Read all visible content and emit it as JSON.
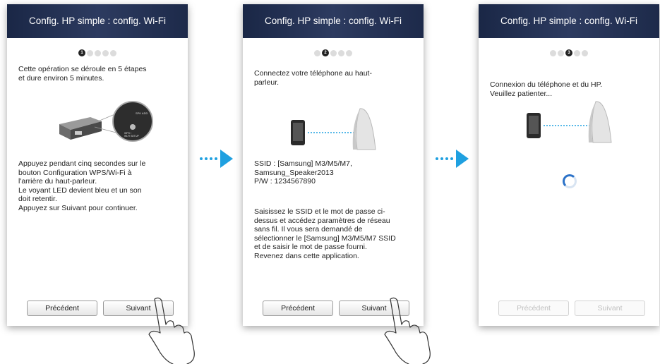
{
  "colors": {
    "header_bg": "#1f2b4c",
    "accent_blue": "#1fa0e0",
    "spinner_blue": "#2b72c8"
  },
  "screens": [
    {
      "title": "Config. HP simple : config. Wi-Fi",
      "step_dots": [
        "1",
        "",
        "",
        "",
        ""
      ],
      "intro": "Cette opération se déroule en 5 étapes\net dure environ 5 minutes.",
      "instructions": "Appuyez pendant cinq secondes sur le\nbouton Configuration WPS/Wi-Fi à\nl'arrière du haut-parleur.\nLe voyant LED devient bleu et un son\ndoit retentir.\nAppuyez sur Suivant pour continuer.",
      "prev_label": "Précédent",
      "next_label": "Suivant"
    },
    {
      "title": "Config. HP simple : config. Wi-Fi",
      "step_dots": [
        "",
        "2",
        "",
        "",
        ""
      ],
      "intro": "Connectez votre téléphone au haut-\nparleur.",
      "ssid_info": "SSID : [Samsung] M3/M5/M7,\n          Samsung_Speaker2013\nP/W : 1234567890",
      "instructions": "Saisissez le SSID et le mot de passe ci-\ndessus et accédez paramètres de réseau\nsans fil. Il vous sera demandé de\nsélectionner le [Samsung] M3/M5/M7 SSID\net de saisir le mot de passe fourni.\nRevenez dans cette application.",
      "prev_label": "Précédent",
      "next_label": "Suivant"
    },
    {
      "title": "Config. HP simple : config. Wi-Fi",
      "step_dots": [
        "",
        "",
        "3",
        "",
        ""
      ],
      "intro": "Connexion du téléphone et du HP.\nVeuillez patienter...",
      "prev_label": "Précédent",
      "next_label": "Suivant"
    }
  ]
}
